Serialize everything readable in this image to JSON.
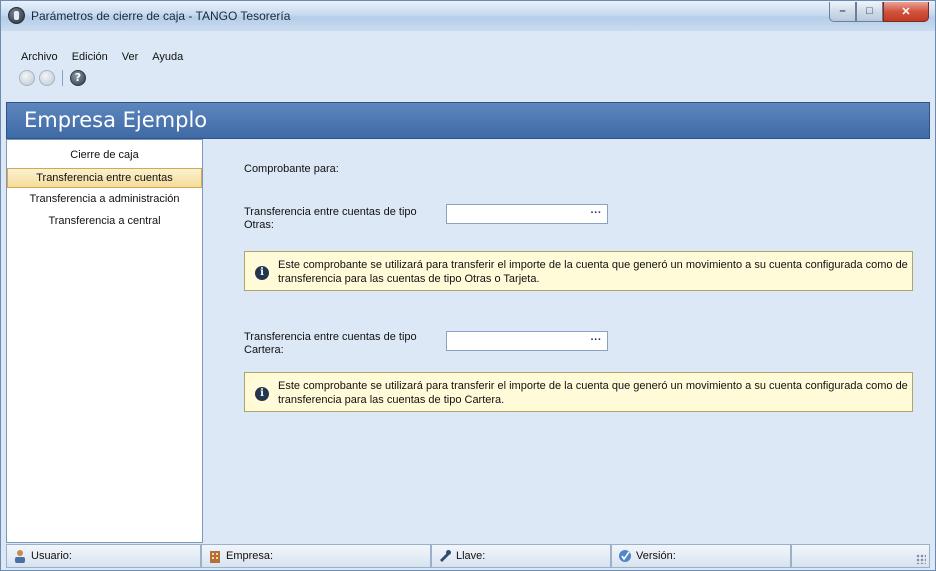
{
  "window": {
    "title": "Parámetros de cierre de caja - TANGO Tesorería"
  },
  "menu": {
    "items": [
      {
        "label": "Archivo"
      },
      {
        "label": "Edición"
      },
      {
        "label": "Ver"
      },
      {
        "label": "Ayuda"
      }
    ]
  },
  "banner": {
    "title": "Empresa Ejemplo"
  },
  "sidebar": {
    "items": [
      {
        "label": "Cierre de caja",
        "active": false
      },
      {
        "label": "Transferencia entre cuentas",
        "active": true
      },
      {
        "label": "Transferencia a administración",
        "active": false
      },
      {
        "label": "Transferencia a central",
        "active": false
      }
    ]
  },
  "main": {
    "heading": "Comprobante para:",
    "otras": {
      "label": "Transferencia entre cuentas de tipo Otras:",
      "value": "",
      "button": "···",
      "info": "Este comprobante se utilizará para transferir el importe de la cuenta que generó un movimiento a su cuenta configurada como de transferencia para las cuentas de tipo Otras o Tarjeta."
    },
    "cartera": {
      "label": "Transferencia entre cuentas de tipo Cartera:",
      "value": "",
      "button": "···",
      "info": "Este comprobante se utilizará para transferir el importe de la cuenta que generó un movimiento a su cuenta configurada como de transferencia para las cuentas de tipo Cartera."
    }
  },
  "statusbar": {
    "usuario": "Usuario:",
    "empresa": "Empresa:",
    "llave": "Llave:",
    "version": "Versión:"
  }
}
